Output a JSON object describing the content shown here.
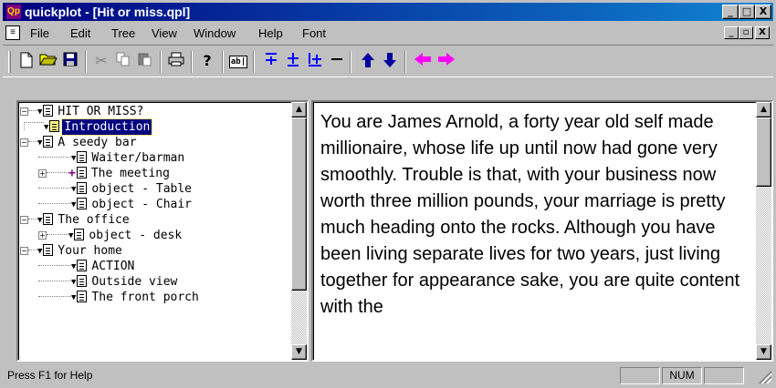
{
  "window": {
    "app_title": "quickplot - [Hit or miss.qpl]",
    "app_icon": "Qp",
    "caption_buttons": [
      "_",
      "□",
      "X"
    ],
    "mdi_buttons": [
      "_",
      "▫",
      "X"
    ]
  },
  "menu": [
    "File",
    "Edit",
    "Tree",
    "View",
    "Window",
    "Help",
    "Font"
  ],
  "toolbar": {
    "icons": [
      "new-document-icon",
      "open-folder-icon",
      "save-disk-icon",
      "cut-icon",
      "copy-icon",
      "paste-icon",
      "print-icon",
      "help-question-icon",
      "text-field-icon",
      "insert-top-icon",
      "insert-sibling-icon",
      "insert-child-icon",
      "delete-node-icon",
      "move-up-icon",
      "move-down-icon",
      "move-left-icon",
      "move-right-icon"
    ],
    "help_glyph": "?",
    "text_glyph": "ab|",
    "colors": {
      "blue": "#0000ff",
      "magenta": "#ff00ff",
      "nav": "#0000a0"
    }
  },
  "tree": {
    "items": [
      {
        "label": "HIT OR MISS?"
      },
      {
        "label": "Introduction",
        "selected": true
      },
      {
        "label": "A seedy bar"
      },
      {
        "label": "Waiter/barman"
      },
      {
        "label": "The meeting"
      },
      {
        "label": "object - Table"
      },
      {
        "label": "object - Chair"
      },
      {
        "label": "The office"
      },
      {
        "label": "object - desk"
      },
      {
        "label": "Your home"
      },
      {
        "label": "ACTION"
      },
      {
        "label": "Outside view"
      },
      {
        "label": "The front porch"
      }
    ]
  },
  "story": {
    "text": "You are James Arnold, a forty year old self made millionaire, whose life up until now had gone very smoothly. Trouble is that, with your business now worth three million pounds, your marriage is pretty much heading onto the rocks. Although you have been living separate lives for two years, just living together for appearance sake, you are quite content with the"
  },
  "status": {
    "help_text": "Press F1 for Help",
    "num": "NUM"
  }
}
